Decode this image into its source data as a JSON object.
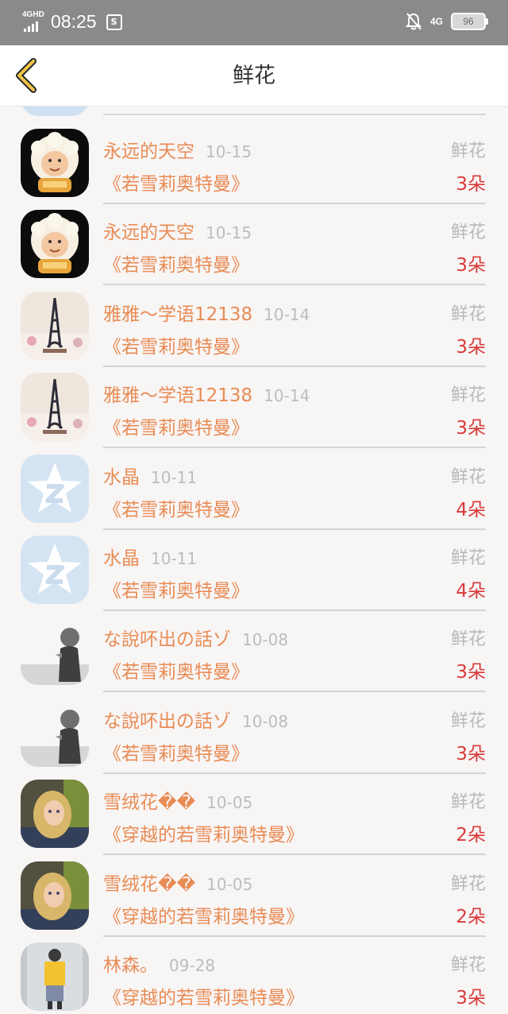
{
  "status_bar": {
    "network_left": "4GHD",
    "time": "08:25",
    "app_icon": "S",
    "network_right": "4G",
    "battery": "96"
  },
  "header": {
    "title": "鲜花",
    "back_icon": "chevron-left-icon"
  },
  "rows": [
    {
      "name": "永远的天空",
      "date": "10-15",
      "type": "鲜花",
      "book": "《若雪莉奥特曼》",
      "count": "3朵",
      "avatar": "cartoon-sheep"
    },
    {
      "name": "永远的天空",
      "date": "10-15",
      "type": "鲜花",
      "book": "《若雪莉奥特曼》",
      "count": "3朵",
      "avatar": "cartoon-sheep"
    },
    {
      "name": "雅雅～学语12138",
      "date": "10-14",
      "type": "鲜花",
      "book": "《若雪莉奥特曼》",
      "count": "3朵",
      "avatar": "eiffel-tower"
    },
    {
      "name": "雅雅～学语12138",
      "date": "10-14",
      "type": "鲜花",
      "book": "《若雪莉奥特曼》",
      "count": "3朵",
      "avatar": "eiffel-tower"
    },
    {
      "name": "水晶",
      "date": "10-11",
      "type": "鲜花",
      "book": "《若雪莉奥特曼》",
      "count": "4朵",
      "avatar": "qq-star"
    },
    {
      "name": "水晶",
      "date": "10-11",
      "type": "鲜花",
      "book": "《若雪莉奥特曼》",
      "count": "4朵",
      "avatar": "qq-star"
    },
    {
      "name": "な說吥出の話ゾ",
      "date": "10-08",
      "type": "鲜花",
      "book": "《若雪莉奥特曼》",
      "count": "3朵",
      "avatar": "child-mono"
    },
    {
      "name": "な說吥出の話ゾ",
      "date": "10-08",
      "type": "鲜花",
      "book": "《若雪莉奥特曼》",
      "count": "3朵",
      "avatar": "child-mono"
    },
    {
      "name": "雪绒花��",
      "date": "10-05",
      "type": "鲜花",
      "book": "《穿越的若雪莉奥特曼》",
      "count": "2朵",
      "avatar": "girl-portrait"
    },
    {
      "name": "雪绒花��",
      "date": "10-05",
      "type": "鲜花",
      "book": "《穿越的若雪莉奥特曼》",
      "count": "2朵",
      "avatar": "girl-portrait"
    },
    {
      "name": "林森。",
      "date": "09-28",
      "type": "鲜花",
      "book": "《穿越的若雪莉奥特曼》",
      "count": "3朵",
      "avatar": "person-yellow"
    }
  ]
}
